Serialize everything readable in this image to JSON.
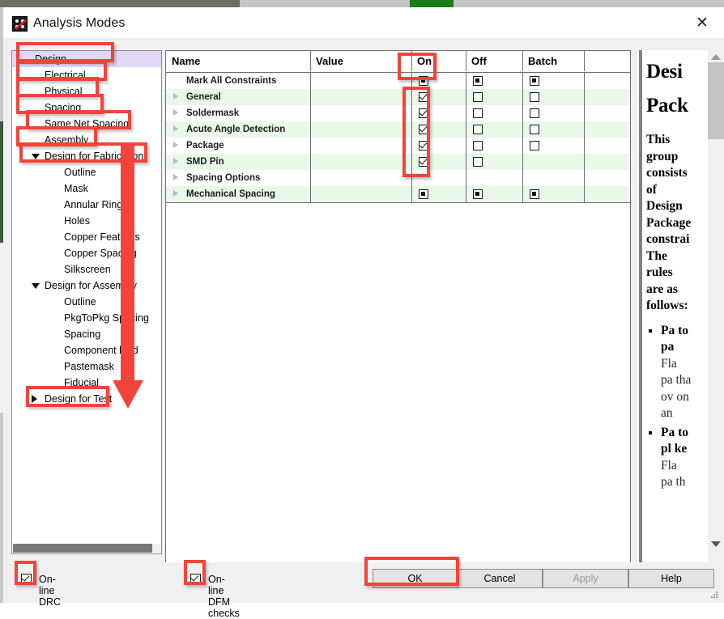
{
  "window": {
    "title": "Analysis Modes",
    "icon": "analysis-modes-icon",
    "close_label": "✕"
  },
  "tree": {
    "items": [
      {
        "label": "Design",
        "indent": 0,
        "expander": "none",
        "selected": true
      },
      {
        "label": "Electrical",
        "indent": 1,
        "expander": "none",
        "selected": false
      },
      {
        "label": "Physical",
        "indent": 1,
        "expander": "none",
        "selected": false
      },
      {
        "label": "Spacing",
        "indent": 1,
        "expander": "none",
        "selected": false
      },
      {
        "label": "Same Net Spacing",
        "indent": 1,
        "expander": "none",
        "selected": false
      },
      {
        "label": "Assembly",
        "indent": 1,
        "expander": "none",
        "selected": false
      },
      {
        "label": "Design for Fabrication",
        "indent": 1,
        "expander": "down",
        "selected": false
      },
      {
        "label": "Outline",
        "indent": 2,
        "expander": "none",
        "selected": false
      },
      {
        "label": "Mask",
        "indent": 2,
        "expander": "none",
        "selected": false
      },
      {
        "label": "Annular Ring",
        "indent": 2,
        "expander": "none",
        "selected": false
      },
      {
        "label": "Holes",
        "indent": 2,
        "expander": "none",
        "selected": false
      },
      {
        "label": "Copper Features",
        "indent": 2,
        "expander": "none",
        "selected": false
      },
      {
        "label": "Copper Spacing",
        "indent": 2,
        "expander": "none",
        "selected": false
      },
      {
        "label": "Silkscreen",
        "indent": 2,
        "expander": "none",
        "selected": false
      },
      {
        "label": "Design for Assembly",
        "indent": 1,
        "expander": "down",
        "selected": false
      },
      {
        "label": "Outline",
        "indent": 2,
        "expander": "none",
        "selected": false
      },
      {
        "label": "PkgToPkg Spacing",
        "indent": 2,
        "expander": "none",
        "selected": false
      },
      {
        "label": "Spacing",
        "indent": 2,
        "expander": "none",
        "selected": false
      },
      {
        "label": "Component lead",
        "indent": 2,
        "expander": "none",
        "selected": false
      },
      {
        "label": "Pastemask",
        "indent": 2,
        "expander": "none",
        "selected": false
      },
      {
        "label": "Fiducial",
        "indent": 2,
        "expander": "none",
        "selected": false
      },
      {
        "label": "Design for Test",
        "indent": 1,
        "expander": "right",
        "selected": false
      }
    ]
  },
  "table": {
    "columns": [
      "Name",
      "Value",
      "On",
      "Off",
      "Batch"
    ],
    "rows": [
      {
        "name": "Mark All Constraints",
        "expander": false,
        "value": "",
        "on": "filled",
        "off": "filled",
        "batch": "filled"
      },
      {
        "name": "General",
        "expander": true,
        "value": "",
        "on": "checked",
        "off": "empty",
        "batch": "empty"
      },
      {
        "name": "Soldermask",
        "expander": true,
        "value": "",
        "on": "checked",
        "off": "empty",
        "batch": "empty"
      },
      {
        "name": "Acute Angle Detection",
        "expander": true,
        "value": "",
        "on": "checked",
        "off": "empty",
        "batch": "empty"
      },
      {
        "name": "Package",
        "expander": true,
        "value": "",
        "on": "checked",
        "off": "empty",
        "batch": "empty"
      },
      {
        "name": "SMD Pin",
        "expander": true,
        "value": "",
        "on": "checked",
        "off": "empty",
        "batch": "none"
      },
      {
        "name": "Spacing Options",
        "expander": true,
        "value": "",
        "on": "none",
        "off": "none",
        "batch": "none"
      },
      {
        "name": "Mechanical Spacing",
        "expander": true,
        "value": "",
        "on": "filled",
        "off": "filled",
        "batch": "filled"
      }
    ]
  },
  "help": {
    "heading_line1": "Desi",
    "heading_line2": "Pack",
    "paragraph1": "This group consists of Design Package constrai",
    "paragraph2": "The rules are as follows:",
    "bullets": [
      {
        "bold": "Pa to pa",
        "rest": "Fla pa tha ov on an"
      },
      {
        "bold": "Pa to pl ke",
        "rest": "Fla pa th"
      }
    ]
  },
  "bottom": {
    "online_drc": {
      "label": "On-line DRC",
      "checked": true
    },
    "online_dfm": {
      "label": "On-line DFM checks",
      "checked": true
    },
    "buttons": [
      {
        "label": "OK",
        "enabled": true
      },
      {
        "label": "Cancel",
        "enabled": true
      },
      {
        "label": "Apply",
        "enabled": false
      },
      {
        "label": "Help",
        "enabled": true
      }
    ]
  },
  "annotations": {
    "color": "#f4433a",
    "boxes": [
      "design-item",
      "electrical-item",
      "physical-item",
      "spacing-item",
      "same-net-spacing-item",
      "assembly-item",
      "design-for-fabrication-item",
      "design-for-test-item",
      "on-column-header",
      "on-column-checkboxes",
      "online-drc-checkbox",
      "online-dfm-checkbox",
      "ok-button"
    ],
    "arrow": "down-arrow"
  }
}
